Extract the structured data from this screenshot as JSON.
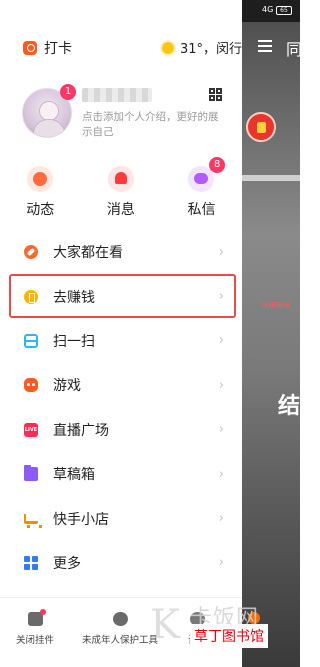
{
  "status_bar": {
    "signal": "4G",
    "battery": "65"
  },
  "video": {
    "peek_char": "同",
    "sign_text": "OSE电源",
    "big_char": "结"
  },
  "drawer": {
    "punch_label": "打卡",
    "weather": "31°，闵行",
    "profile": {
      "avatar_badge": "1",
      "bio": "点击添加个人介绍，更好的展示自己"
    },
    "quick_actions": [
      {
        "label": "动态",
        "badge": ""
      },
      {
        "label": "消息",
        "badge": ""
      },
      {
        "label": "私信",
        "badge": "8"
      }
    ],
    "menu": [
      {
        "label": "大家都在看",
        "icon": "compass-icon"
      },
      {
        "label": "去赚钱",
        "icon": "coin-icon"
      },
      {
        "label": "扫一扫",
        "icon": "scan-icon"
      },
      {
        "label": "游戏",
        "icon": "game-icon"
      },
      {
        "label": "直播广场",
        "icon": "live-icon"
      },
      {
        "label": "草稿箱",
        "icon": "folder-icon"
      },
      {
        "label": "快手小店",
        "icon": "cart-icon"
      },
      {
        "label": "更多",
        "icon": "grid-icon"
      }
    ],
    "live_icon_text": "LIVE",
    "bottom": {
      "close_widget": "关闭挂件",
      "minor_protection": "未成年人保护工具",
      "settings": "设置"
    }
  },
  "watermark": {
    "top": "卡饭网",
    "bottom": "草丁图书馆"
  },
  "colors": {
    "highlight": "#ea4b4b",
    "badge": "#fe3666",
    "accent": "#ff5a1f"
  }
}
